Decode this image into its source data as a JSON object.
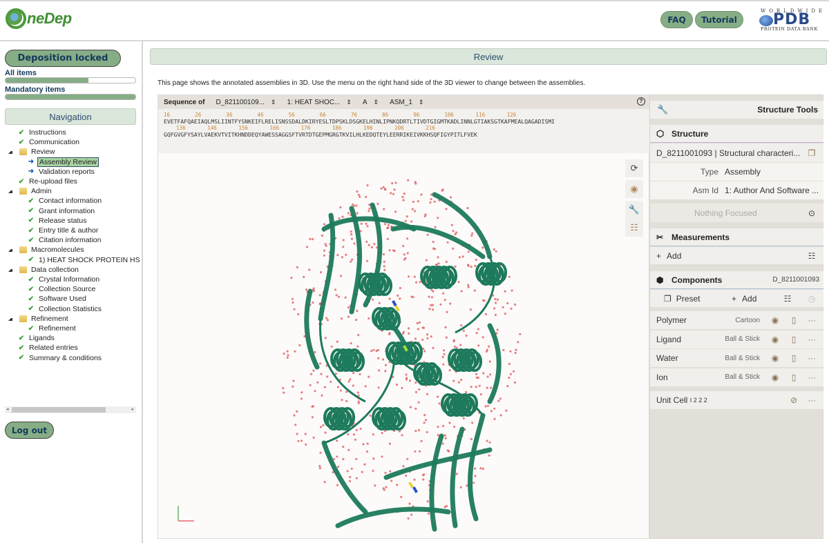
{
  "header": {
    "logo_text": "neDep",
    "faq_label": "FAQ",
    "tutorial_label": "Tutorial",
    "pdb_logo": {
      "top": "WORLDWIDE",
      "main": "PDB",
      "bottom": "PROTEIN DATA BANK"
    }
  },
  "sidebar": {
    "deposition_button": "Deposition locked",
    "all_items_label": "All items",
    "all_items_progress": 0.64,
    "mandatory_items_label": "Mandatory items",
    "mandatory_items_progress": 1.0,
    "navigation_title": "Navigation",
    "tree": [
      {
        "label": "Instructions",
        "icon": "check-icon",
        "level": 0
      },
      {
        "label": "Communication",
        "icon": "check-icon",
        "level": 0
      },
      {
        "label": "Review",
        "icon": "folder-icon",
        "level": 0,
        "expanded": true
      },
      {
        "label": "Assembly Review",
        "icon": "arrow-right-icon",
        "level": 1,
        "selected": true
      },
      {
        "label": "Validation reports",
        "icon": "arrow-right-icon",
        "level": 1
      },
      {
        "label": "Re-upload files",
        "icon": "check-icon",
        "level": 0
      },
      {
        "label": "Admin",
        "icon": "folder-icon",
        "level": 0,
        "expanded": true
      },
      {
        "label": "Contact information",
        "icon": "check-icon",
        "level": 1
      },
      {
        "label": "Grant information",
        "icon": "check-icon",
        "level": 1
      },
      {
        "label": "Release status",
        "icon": "check-icon",
        "level": 1
      },
      {
        "label": "Entry title & author",
        "icon": "check-icon",
        "level": 1
      },
      {
        "label": "Citation information",
        "icon": "check-icon",
        "level": 1
      },
      {
        "label": "Macromolecules",
        "icon": "folder-icon",
        "level": 0,
        "expanded": true
      },
      {
        "label": "1) HEAT SHOCK PROTEIN HS",
        "icon": "check-icon",
        "level": 1
      },
      {
        "label": "Data collection",
        "icon": "folder-icon",
        "level": 0,
        "expanded": true
      },
      {
        "label": "Crystal Information",
        "icon": "check-icon",
        "level": 1
      },
      {
        "label": "Collection Source",
        "icon": "check-icon",
        "level": 1
      },
      {
        "label": "Software Used",
        "icon": "check-icon",
        "level": 1
      },
      {
        "label": "Collection Statistics",
        "icon": "check-icon",
        "level": 1
      },
      {
        "label": "Refinement",
        "icon": "folder-icon",
        "level": 0,
        "expanded": true
      },
      {
        "label": "Refinement",
        "icon": "check-icon",
        "level": 1
      },
      {
        "label": "Ligands",
        "icon": "check-icon",
        "level": 0
      },
      {
        "label": "Related entries",
        "icon": "check-icon",
        "level": 0
      },
      {
        "label": "Summary & conditions",
        "icon": "check-icon",
        "level": 0
      }
    ],
    "logout_button": "Log out"
  },
  "main": {
    "section_title": "Review",
    "intro_text": "This page shows the annotated assemblies in 3D. Use the menu on the right hand side of the 3D viewer to change between the assemblies.",
    "sequence": {
      "title": "Sequence of",
      "entry_select": "D_821100109...",
      "entity_select": "1: HEAT SHOC...",
      "chain_select": "A",
      "assembly_select": "ASM_1",
      "line1_numbers": [
        "16",
        "26",
        "36",
        "46",
        "56",
        "66",
        "76",
        "86",
        "96",
        "106",
        "116",
        "126"
      ],
      "line1": "EVETFAFQAEIAQLMSLIINTFYSNKEIFLRELISNSSDALDKIRYESLTDPSKLDSGKELHINLIPNKQDRTLTIVDTGIGMTKADLINNLGTIAKSGTKAFMEALQAGADISMI",
      "line2_numbers": [
        "136",
        "146",
        "156",
        "166",
        "176",
        "186",
        "196",
        "206",
        "216"
      ],
      "line2": "GQFGVGFYSAYLVAEKVTVITKHNDDEQYAWESSAGGSFTVRTDTGEPMGRGTKVILHLKEDQTEYLEERRIKEIVKKHSQFIGYPITLFVEK"
    },
    "viewer_colors": {
      "cartoon": "#1e7a5c",
      "water": "#e05555",
      "background": "#fcfbfa"
    }
  },
  "structure_tools": {
    "title": "Structure Tools",
    "structure_section": "Structure",
    "structure_name": "D_8211001093 | Structural characteri...",
    "type_label": "Type",
    "type_value": "Assembly",
    "asm_label": "Asm Id",
    "asm_value": "1: Author And Software ...",
    "focus_text": "Nothing Focused",
    "measurements_section": "Measurements",
    "measurements_add": "Add",
    "components_section": "Components",
    "components_id": "D_8211001093",
    "preset_label": "Preset",
    "components_add": "Add",
    "components": [
      {
        "name": "Polymer",
        "repr": "Cartoon"
      },
      {
        "name": "Ligand",
        "repr": "Ball & Stick"
      },
      {
        "name": "Water",
        "repr": "Ball & Stick"
      },
      {
        "name": "Ion",
        "repr": "Ball & Stick"
      }
    ],
    "unit_cell_label": "Unit Cell",
    "unit_cell_suffix": "I 2 2 2"
  }
}
